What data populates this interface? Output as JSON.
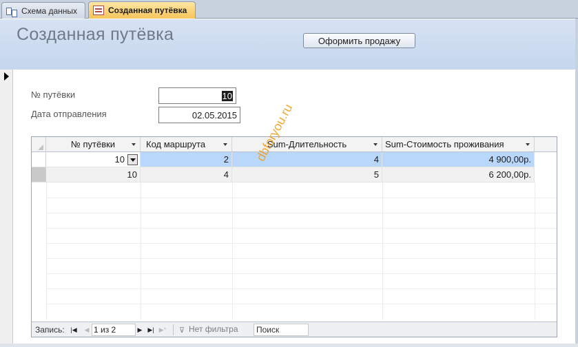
{
  "tabs": [
    {
      "label": "Схема данных",
      "icon": "relationships-icon",
      "active": false
    },
    {
      "label": "Созданная путёвка",
      "icon": "form-icon",
      "active": true
    }
  ],
  "form": {
    "title": "Созданная путёвка",
    "sell_button": "Оформить продажу",
    "voucher_label": "№ путёвки",
    "voucher_value": "10",
    "date_label": "Дата отправления",
    "date_value": "02.05.2015"
  },
  "subform": {
    "columns": [
      "№ путёвки",
      "Код маршрута",
      "Sum-Длительность",
      "Sum-Стоимость проживания"
    ],
    "rows": [
      [
        "10",
        "2",
        "4",
        "4 900,00р."
      ],
      [
        "10",
        "4",
        "5",
        "6 200,00р."
      ]
    ]
  },
  "navigation": {
    "label": "Запись:",
    "record_position": "1 из 2",
    "filter_label": "Нет фильтра",
    "search_placeholder": "Поиск"
  },
  "watermark": "dbforyou.ru",
  "colors": {
    "header_bg": "#c5d6ee",
    "active_tab": "#f7c55a",
    "selected_row": "#b8d7fb",
    "watermark": "#f0a01e"
  }
}
